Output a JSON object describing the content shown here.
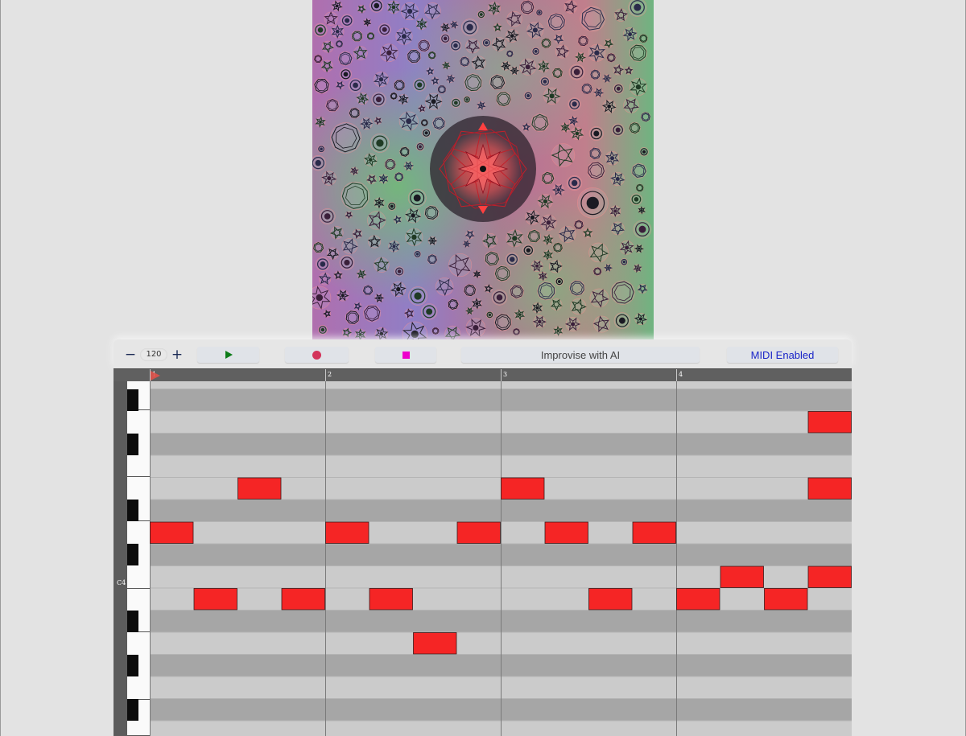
{
  "toolbar": {
    "tempo": {
      "value": "120",
      "minus_label": "−",
      "plus_label": "+"
    },
    "play_icon": "play-icon",
    "record_icon": "record-icon",
    "stop_icon": "stop-icon",
    "improvise_label": "Improvise with AI",
    "midi_label": "MIDI Enabled"
  },
  "timeline": {
    "bars": [
      "1",
      "2",
      "3",
      "4"
    ]
  },
  "keyboard": {
    "octave_label": "C4"
  },
  "colors": {
    "note_fill": "#f52525",
    "row_light": "#cbcbcb",
    "row_dark": "#a6a6a6",
    "bar_line": "#7a7a7a",
    "ruler": "#606060",
    "play_green": "#0d7c18",
    "record_red": "#d3335a",
    "stop_magenta": "#ee00cc",
    "midi_blue": "#1a25c8"
  },
  "piano_roll": {
    "steps_per_bar": 4,
    "visible_rows": 16,
    "notes": [
      {
        "row": 1,
        "start": 15,
        "length": 1
      },
      {
        "row": 4,
        "start": 2,
        "length": 1
      },
      {
        "row": 4,
        "start": 8,
        "length": 1
      },
      {
        "row": 4,
        "start": 15,
        "length": 1
      },
      {
        "row": 6,
        "start": 0,
        "length": 1
      },
      {
        "row": 6,
        "start": 4,
        "length": 1
      },
      {
        "row": 6,
        "start": 7,
        "length": 1
      },
      {
        "row": 6,
        "start": 9,
        "length": 1
      },
      {
        "row": 6,
        "start": 11,
        "length": 1
      },
      {
        "row": 8,
        "start": 13,
        "length": 1
      },
      {
        "row": 8,
        "start": 15,
        "length": 1
      },
      {
        "row": 9,
        "start": 1,
        "length": 1
      },
      {
        "row": 9,
        "start": 3,
        "length": 1
      },
      {
        "row": 9,
        "start": 5,
        "length": 1
      },
      {
        "row": 9,
        "start": 10,
        "length": 1
      },
      {
        "row": 9,
        "start": 12,
        "length": 1
      },
      {
        "row": 9,
        "start": 14,
        "length": 1
      },
      {
        "row": 11,
        "start": 6,
        "length": 1
      }
    ]
  }
}
